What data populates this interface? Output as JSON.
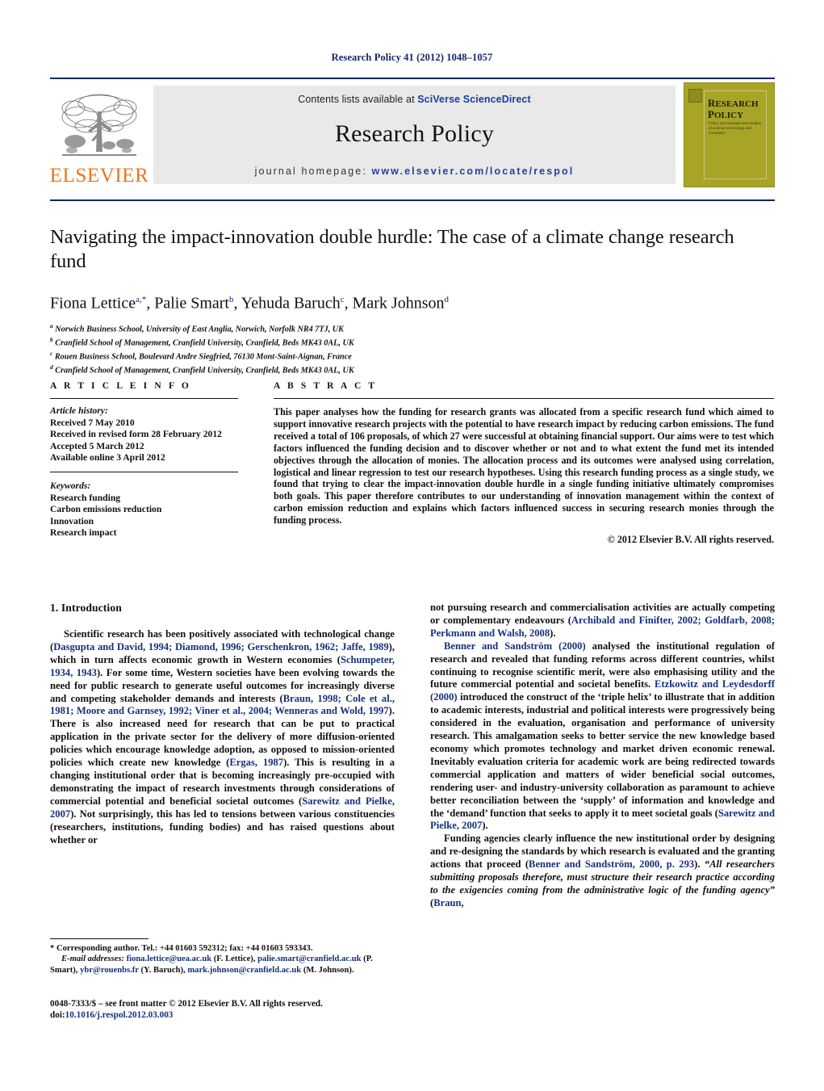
{
  "running_head": "Research Policy 41 (2012) 1048–1057",
  "masthead": {
    "contents_prefix": "Contents lists available at ",
    "contents_link": "SciVerse ScienceDirect",
    "journal_name": "Research Policy",
    "homepage_prefix": "journal homepage: ",
    "homepage_url": "www.elsevier.com/locate/respol",
    "publisher": "ELSEVIER",
    "cover": {
      "line1": "R",
      "line1b": "ESEARCH",
      "line2": "P",
      "line2b": "OLICY",
      "subtitle": "Policy and management studies of science technology and innovation"
    }
  },
  "article": {
    "title": "Navigating the impact-innovation double hurdle: The case of a climate change research fund",
    "authors": [
      {
        "name": "Fiona Lettice",
        "sup": "a,*"
      },
      {
        "name": "Palie Smart",
        "sup": "b"
      },
      {
        "name": "Yehuda Baruch",
        "sup": "c"
      },
      {
        "name": "Mark Johnson",
        "sup": "d"
      }
    ],
    "affiliations": [
      {
        "marker": "a",
        "text": "Norwich Business School, University of East Anglia, Norwich, Norfolk NR4 7TJ, UK"
      },
      {
        "marker": "b",
        "text": "Cranfield School of Management, Cranfield University, Cranfield, Beds MK43 0AL, UK"
      },
      {
        "marker": "c",
        "text": "Rouen Business School, Boulevard Andre Siegfried, 76130 Mont-Saint-Aignan, France"
      },
      {
        "marker": "d",
        "text": "Cranfield School of Management, Cranfield University, Cranfield, Beds MK43 0AL, UK"
      }
    ]
  },
  "article_info": {
    "heading": "A R T I C L E   I N F O",
    "history_label": "Article history:",
    "history": [
      "Received 7 May 2010",
      "Received in revised form 28 February 2012",
      "Accepted 5 March 2012",
      "Available online 3 April 2012"
    ],
    "keywords_label": "Keywords:",
    "keywords": [
      "Research funding",
      "Carbon emissions reduction",
      "Innovation",
      "Research impact"
    ]
  },
  "abstract": {
    "heading": "A B S T R A C T",
    "text": "This paper analyses how the funding for research grants was allocated from a specific research fund which aimed to support innovative research projects with the potential to have research impact by reducing carbon emissions. The fund received a total of 106 proposals, of which 27 were successful at obtaining financial support. Our aims were to test which factors influenced the funding decision and to discover whether or not and to what extent the fund met its intended objectives through the allocation of monies. The allocation process and its outcomes were analysed using correlation, logistical and linear regression to test our research hypotheses. Using this research funding process as a single study, we found that trying to clear the impact-innovation double hurdle in a single funding initiative ultimately compromises both goals. This paper therefore contributes to our understanding of innovation management within the context of carbon emission reduction and explains which factors influenced success in securing research monies through the funding process.",
    "copyright": "© 2012 Elsevier B.V. All rights reserved."
  },
  "section": {
    "number_title": "1.  Introduction"
  },
  "left_column": {
    "para1_a": "Scientific research has been positively associated with technological change (",
    "para1_ref1": "Dasgupta and David, 1994; Diamond, 1996; Gerschenkron, 1962; Jaffe, 1989",
    "para1_b": "), which in turn affects economic growth in Western economies (",
    "para1_ref2": "Schumpeter, 1934, 1943",
    "para1_c": "). For some time, Western societies have been evolving towards the need for public research to generate useful outcomes for increasingly diverse and competing stakeholder demands and interests (",
    "para1_ref3": "Braun, 1998; Cole et al., 1981; Moore and Garnsey, 1992; Viner et al., 2004; Wenneras and Wold, 1997",
    "para1_d": "). There is also increased need for research that can be put to practical application in the private sector for the delivery of more diffusion-oriented policies which encourage knowledge adoption, as opposed to mission-oriented policies which create new knowledge (",
    "para1_ref4": "Ergas, 1987",
    "para1_e": "). This is resulting in a changing institutional order that is becoming increasingly pre-occupied with demonstrating the impact of research investments through considerations of commercial potential and beneficial societal outcomes (",
    "para1_ref5": "Sarewitz and Pielke, 2007",
    "para1_f": "). Not surprisingly, this has led to tensions between various constituencies (researchers, institutions, funding bodies) and has raised questions about whether or"
  },
  "right_column": {
    "para1_cont_a": "not pursuing research and commercialisation activities are actually competing or complementary endeavours (",
    "para1_cont_ref": "Archibald and Finifter, 2002; Goldfarb, 2008; Perkmann and Walsh, 2008",
    "para1_cont_b": ").",
    "para2_ref1": "Benner and Sandström (2000)",
    "para2_a": " analysed the institutional regulation of research and revealed that funding reforms across different countries, whilst continuing to recognise scientific merit, were also emphasising utility and the future commercial potential and societal benefits. ",
    "para2_ref2": "Etzkowitz and Leydesdorff (2000)",
    "para2_b": " introduced the construct of the ‘triple helix’ to illustrate that in addition to academic interests, industrial and political interests were progressively being considered in the evaluation, organisation and performance of university research. This amalgamation seeks to better service the new knowledge based economy which promotes technology and market driven economic renewal. Inevitably evaluation criteria for academic work are being redirected towards commercial application and matters of wider beneficial social outcomes, rendering user- and industry-university collaboration as paramount to achieve better reconciliation between the ‘supply’ of information and knowledge and the ‘demand’ function that seeks to apply it to meet societal goals (",
    "para2_ref3": "Sarewitz and Pielke, 2007",
    "para2_c": ").",
    "para3_a": "Funding agencies clearly influence the new institutional order by designing and re-designing the standards by which research is evaluated and the granting actions that proceed (",
    "para3_ref1": "Benner and Sandström, 2000, p. 293",
    "para3_b": "). ",
    "para3_quote": "“All researchers submitting proposals therefore, must structure their research practice according to the exigencies coming from the administrative logic of the funding agency”",
    "para3_c": " (",
    "para3_ref2": "Braun,",
    "para3_d": ""
  },
  "footnotes": {
    "corresponding": "* Corresponding author. Tel.: +44 01603 592312; fax: +44 01603 593343.",
    "email_label": "E-mail addresses:",
    "emails": [
      {
        "address": "fiona.lettice@uea.ac.uk",
        "owner": " (F. Lettice), "
      },
      {
        "address": "palie.smart@cranfield.ac.uk",
        "owner": " (P. Smart), "
      },
      {
        "address": "ybr@rouenbs.fr",
        "owner": " (Y. Baruch), "
      },
      {
        "address": "mark.johnson@cranfield.ac.uk",
        "owner": " (M. Johnson)."
      }
    ]
  },
  "imprint": {
    "issn_line": "0048-7333/$ – see front matter © 2012 Elsevier B.V. All rights reserved.",
    "doi_label": "doi:",
    "doi_value": "10.1016/j.respol.2012.03.003"
  },
  "colors": {
    "link": "#15307e",
    "runhead": "#15256b",
    "elsevier_orange": "#e8761c",
    "cover_olive": "#a8a526",
    "band_gray": "#e9e9e9"
  }
}
